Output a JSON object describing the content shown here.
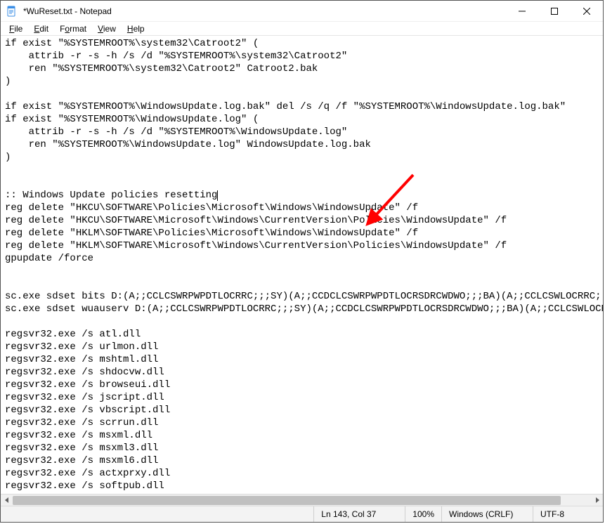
{
  "window": {
    "title": "*WuReset.txt - Notepad"
  },
  "menu": {
    "file": "File",
    "edit": "Edit",
    "format": "Format",
    "view": "View",
    "help": "Help"
  },
  "editor": {
    "lines": [
      "if exist \"%SYSTEMROOT%\\system32\\Catroot2\" (",
      "    attrib -r -s -h /s /d \"%SYSTEMROOT%\\system32\\Catroot2\"",
      "    ren \"%SYSTEMROOT%\\system32\\Catroot2\" Catroot2.bak",
      ")",
      "",
      "if exist \"%SYSTEMROOT%\\WindowsUpdate.log.bak\" del /s /q /f \"%SYSTEMROOT%\\WindowsUpdate.log.bak\"",
      "if exist \"%SYSTEMROOT%\\WindowsUpdate.log\" (",
      "    attrib -r -s -h /s /d \"%SYSTEMROOT%\\WindowsUpdate.log\"",
      "    ren \"%SYSTEMROOT%\\WindowsUpdate.log\" WindowsUpdate.log.bak",
      ")",
      "",
      "",
      ":: Windows Update policies resetting",
      "reg delete \"HKCU\\SOFTWARE\\Policies\\Microsoft\\Windows\\WindowsUpdate\" /f",
      "reg delete \"HKCU\\SOFTWARE\\Microsoft\\Windows\\CurrentVersion\\Policies\\WindowsUpdate\" /f",
      "reg delete \"HKLM\\SOFTWARE\\Policies\\Microsoft\\Windows\\WindowsUpdate\" /f",
      "reg delete \"HKLM\\SOFTWARE\\Microsoft\\Windows\\CurrentVersion\\Policies\\WindowsUpdate\" /f",
      "gpupdate /force",
      "",
      "",
      "sc.exe sdset bits D:(A;;CCLCSWRPWPDTLOCRRC;;;SY)(A;;CCDCLCSWRPWPDTLOCRSDRCWDWO;;;BA)(A;;CCLCSWLOCRRC;;;AU",
      "sc.exe sdset wuauserv D:(A;;CCLCSWRPWPDTLOCRRC;;;SY)(A;;CCDCLCSWRPWPDTLOCRSDRCWDWO;;;BA)(A;;CCLCSWLOCRRC",
      "",
      "regsvr32.exe /s atl.dll",
      "regsvr32.exe /s urlmon.dll",
      "regsvr32.exe /s mshtml.dll",
      "regsvr32.exe /s shdocvw.dll",
      "regsvr32.exe /s browseui.dll",
      "regsvr32.exe /s jscript.dll",
      "regsvr32.exe /s vbscript.dll",
      "regsvr32.exe /s scrrun.dll",
      "regsvr32.exe /s msxml.dll",
      "regsvr32.exe /s msxml3.dll",
      "regsvr32.exe /s msxml6.dll",
      "regsvr32.exe /s actxprxy.dll",
      "regsvr32.exe /s softpub.dll"
    ],
    "caret_line_index": 12
  },
  "status": {
    "position": "Ln 143, Col 37",
    "zoom": "100%",
    "line_ending": "Windows (CRLF)",
    "encoding": "UTF-8"
  },
  "annotation": {
    "color": "#ff0000"
  }
}
